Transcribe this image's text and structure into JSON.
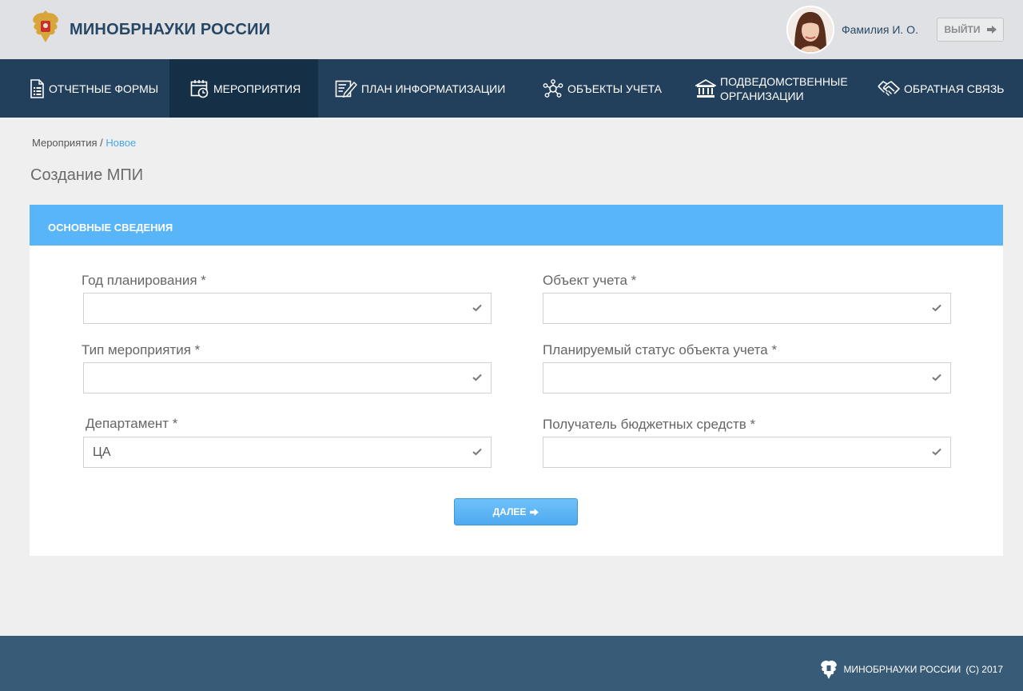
{
  "header": {
    "brand": "МИНОБРНАУКИ РОССИИ",
    "user_name": "Фамилия И. О.",
    "logout_label": "ВЫЙТИ"
  },
  "nav": {
    "items": [
      {
        "label": "ОТЧЕТНЫЕ ФОРМЫ",
        "icon": "document-icon",
        "active": false
      },
      {
        "label": "МЕРОПРИЯТИЯ",
        "icon": "calendar-clock-icon",
        "active": true
      },
      {
        "label": "ПЛАН ИНФОРМАТИЗАЦИИ",
        "icon": "edit-list-icon",
        "active": false
      },
      {
        "label": "ОБЪЕКТЫ УЧЕТА",
        "icon": "network-icon",
        "active": false
      },
      {
        "label_line1": "ПОДВЕДОМСТВЕННЫЕ",
        "label_line2": "ОРГАНИЗАЦИИ",
        "icon": "institution-icon",
        "active": false
      },
      {
        "label": "ОБРАТНАЯ СВЯЗЬ",
        "icon": "handshake-icon",
        "active": false
      }
    ]
  },
  "breadcrumb": {
    "parent": "Мероприятия",
    "separator": " / ",
    "current": "Новое"
  },
  "page_title": "Создание МПИ",
  "section": {
    "title": "ОСНОВНЫЕ СВЕДЕНИЯ"
  },
  "form": {
    "year": {
      "label": "Год планирования *",
      "value": ""
    },
    "type": {
      "label": "Тип мероприятия *",
      "value": ""
    },
    "department": {
      "label": "Департамент *",
      "value": "ЦА"
    },
    "object": {
      "label": "Объект учета *",
      "value": ""
    },
    "status": {
      "label": "Планируемый статус объекта учета *",
      "value": ""
    },
    "recipient": {
      "label": "Получатель бюджетных средств *",
      "value": ""
    },
    "next_label": "ДАЛЕЕ"
  },
  "footer": {
    "text": "МИНОБРНАУКИ РОССИИ",
    "copyright": "(С) 2017"
  },
  "colors": {
    "nav_bg": "#223f5b",
    "nav_active": "#152f47",
    "section_header": "#58b5f8",
    "link": "#46a8e6",
    "footer_bg": "#385b77"
  }
}
